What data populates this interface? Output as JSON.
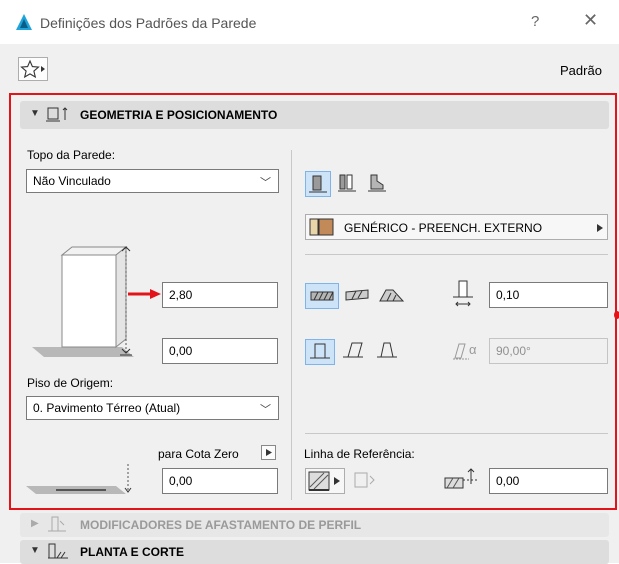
{
  "window": {
    "title": "Definições dos Padrões da Parede",
    "help": "?",
    "close": "✕"
  },
  "toolbar": {
    "favorites_icon": "star-icon",
    "default_label": "Padrão"
  },
  "geometry_panel": {
    "title": "GEOMETRIA E POSICIONAMENTO",
    "top_label": "Topo da Parede:",
    "top_value": "Não Vinculado",
    "height_value": "2,80",
    "offset_value": "0,00",
    "home_story_label": "Piso de Origem:",
    "home_story_value": "0. Pavimento Térreo (Atual)",
    "to_zero_label": "para Cota Zero",
    "zero_value": "0,00",
    "building_material": "GENÉRICO - PREENCH. EXTERNO",
    "thickness_value": "0,10",
    "slant_angle": "90,00°",
    "slant_alpha": "α",
    "reference_line_label": "Linha de Referência:",
    "reference_offset_value": "0,00"
  },
  "collapsed_panels": [
    {
      "title": "MODIFICADORES DE AFASTAMENTO DE PERFIL"
    },
    {
      "title": "PLANTA E CORTE"
    }
  ],
  "colors": {
    "highlight_frame": "#e3131a",
    "arrow": "#e3131a",
    "selected_button": "#cde3f8",
    "icon_blue": "#1fa3d9"
  }
}
